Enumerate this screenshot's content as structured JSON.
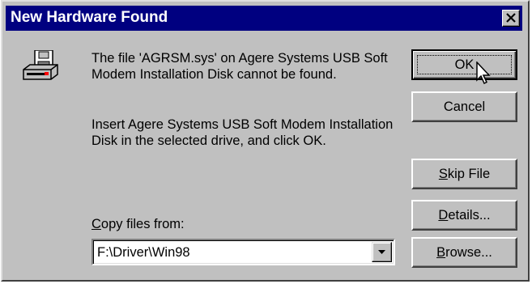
{
  "window": {
    "title": "New Hardware Found",
    "title_bar_color": "#000080",
    "close_icon": "close-x-icon"
  },
  "icon": {
    "name": "hardware-disk-drive-icon"
  },
  "message": {
    "line1": "The file 'AGRSM.sys' on Agere Systems USB Soft Modem Installation Disk cannot be found.",
    "line2": "Insert Agere Systems USB Soft Modem Installation Disk in the selected drive, and click OK."
  },
  "copy_from": {
    "label_key": "C",
    "label_rest": "opy files from:",
    "value": "F:\\Driver\\Win98"
  },
  "buttons": {
    "ok": "OK",
    "cancel": "Cancel",
    "skip_key": "S",
    "skip_rest": "kip File",
    "details_key": "D",
    "details_rest": "etails...",
    "browse_key": "B",
    "browse_rest": "rowse..."
  }
}
